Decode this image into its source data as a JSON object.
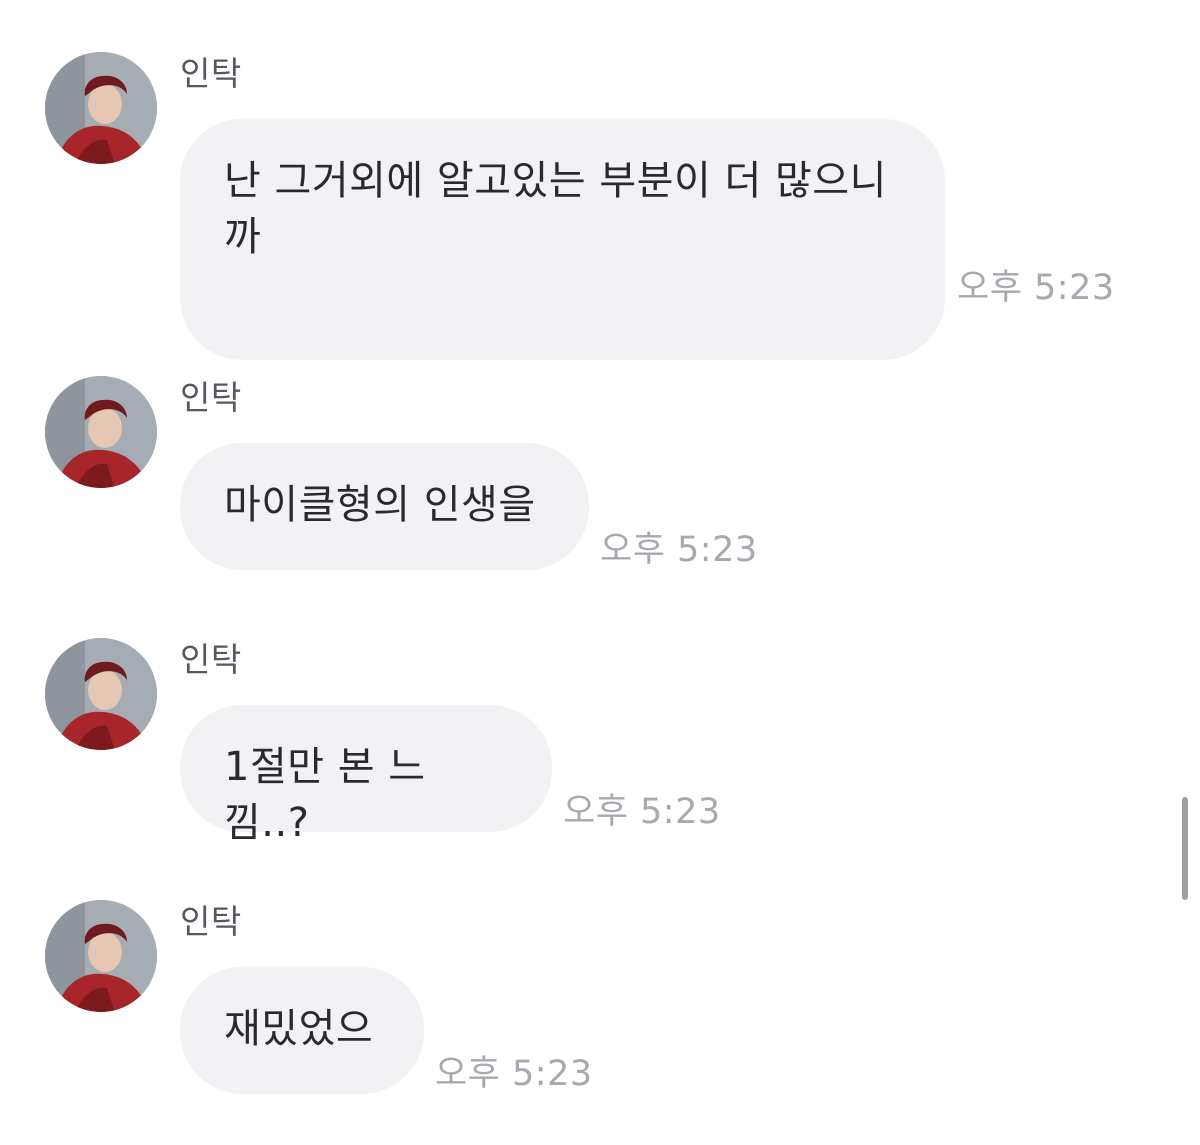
{
  "messages": [
    {
      "sender": "인탁",
      "text": "난 그거외에 알고있는 부분이 더 많으니까",
      "time": "오후 5:23"
    },
    {
      "sender": "인탁",
      "text": "마이클형의 인생을",
      "time": "오후 5:23"
    },
    {
      "sender": "인탁",
      "text": "1절만 본 느낌..?",
      "time": "오후 5:23"
    },
    {
      "sender": "인탁",
      "text": "재밌었으",
      "time": "오후 5:23"
    }
  ],
  "colors": {
    "bubble": "#f2f2f5",
    "text": "#2a2a2c",
    "sender": "#55585e",
    "time": "#a7a9ae",
    "avatar_shirt": "#a8262a"
  }
}
